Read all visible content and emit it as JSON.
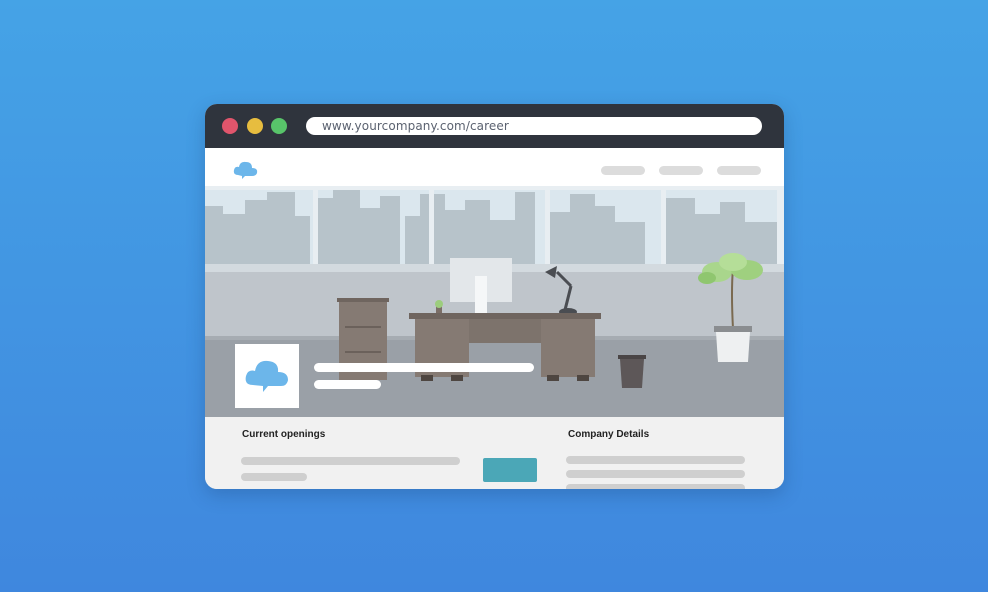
{
  "browser": {
    "window_controls": [
      {
        "name": "close",
        "color": "#e0556c"
      },
      {
        "name": "minimize",
        "color": "#e7bd3f"
      },
      {
        "name": "maximize",
        "color": "#58c46a"
      }
    ],
    "url": "www.yourcompany.com/career"
  },
  "nav": {
    "logo_icon": "cloud-icon",
    "link_count": 3
  },
  "hero": {
    "logo_icon": "cloud-icon",
    "scene": "office-illustration"
  },
  "content": {
    "openings_title": "Current openings",
    "company_title": "Company Details"
  },
  "colors": {
    "background_top": "#45a3e6",
    "background_bottom": "#3f87de",
    "chrome": "#2f343d",
    "accent_cloud": "#6cb6ea",
    "apply_button": "#4ba7b7"
  }
}
